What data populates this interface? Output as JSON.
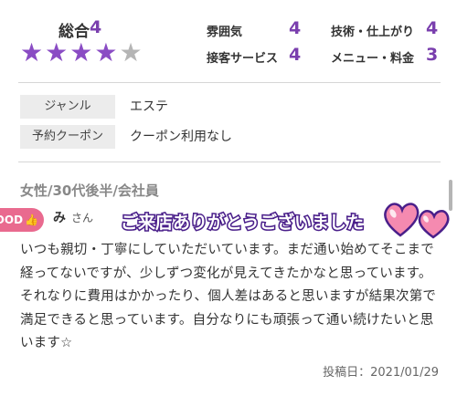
{
  "rating": {
    "overall_label": "総合",
    "overall_value": "4",
    "stars_filled": 4,
    "stars_total": 5,
    "items": [
      {
        "label": "雰囲気",
        "value": "4"
      },
      {
        "label": "技術・仕上がり",
        "value": "4"
      },
      {
        "label": "接客サービス",
        "value": "4"
      },
      {
        "label": "メニュー・料金",
        "value": "3"
      }
    ]
  },
  "info": {
    "genre_label": "ジャンル",
    "genre_value": "エステ",
    "coupon_label": "予約クーポン",
    "coupon_value": "クーポン利用なし"
  },
  "review": {
    "reviewer_profile": "女性/30代後半/会社員",
    "good_badge": "GOOD",
    "nickname": "み",
    "nickname_suffix": "さん",
    "stamp_text": "ご来店ありがとうございました",
    "body": "いつも親切・丁寧にしていただいています。まだ通い始めてそこまで経ってないですが、少しずつ変化が見えてきたかなと思っています。それなりに費用はかかったり、個人差はあると思いますが結果次第で満足できると思っています。自分なりにも頑張って通い続けたいと思います☆",
    "posted_date": "投稿日：2021/01/29"
  },
  "colors": {
    "accent": "#7a3fae",
    "star_on": "#8a4cc4",
    "star_off": "#b5b5b5",
    "badge": "#e96a8f",
    "heart": "#f06a9a"
  }
}
